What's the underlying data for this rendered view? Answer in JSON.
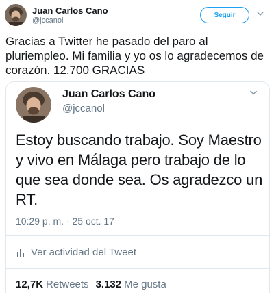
{
  "outer_tweet": {
    "name": "Juan Carlos Cano",
    "handle": "@jccanol",
    "follow_label": "Seguir",
    "text": "Gracias a Twitter he pasado del paro al pluriempleo. Mi familia y yo os lo agradecemos de corazón. 12.700 GRACIAS",
    "menu_icon": "chevron-down-icon"
  },
  "quoted_tweet": {
    "name": "Juan Carlos Cano",
    "handle": "@jccanol",
    "text": "Estoy buscando trabajo. Soy Maestro y vivo en Málaga pero trabajo de lo que sea donde sea. Os agradezco un RT.",
    "timestamp": "10:29 p. m. · 25 oct. 17",
    "activity_label": "Ver actividad del Tweet",
    "activity_icon": "bar-chart-icon",
    "menu_icon": "chevron-down-icon",
    "stats": {
      "retweets_count": "12,7K",
      "retweets_label": "Retweets",
      "likes_count": "3.132",
      "likes_label": "Me gusta"
    }
  },
  "colors": {
    "accent": "#1da1f2",
    "secondary_text": "#657786",
    "border": "#e1e8ed"
  }
}
